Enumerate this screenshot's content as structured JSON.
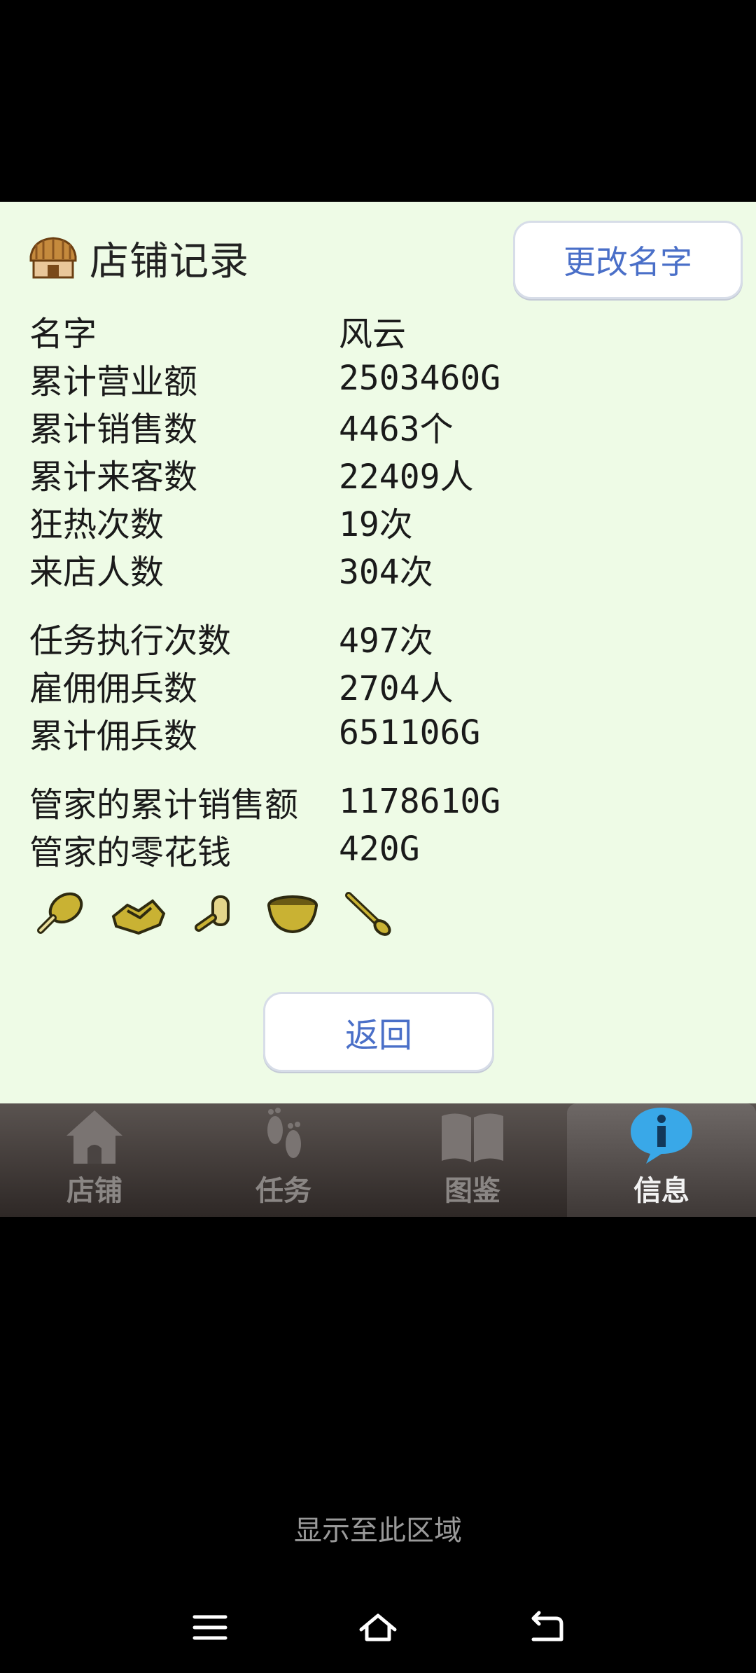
{
  "header": {
    "title": "店铺记录",
    "rename_label": "更改名字"
  },
  "stats": [
    [
      {
        "label": "名字",
        "value": "风云"
      },
      {
        "label": "累计营业额",
        "value": "2503460G"
      },
      {
        "label": "累计销售数",
        "value": "4463个"
      },
      {
        "label": "累计来客数",
        "value": "22409人"
      },
      {
        "label": "狂热次数",
        "value": "19次"
      },
      {
        "label": "来店人数",
        "value": "304次"
      }
    ],
    [
      {
        "label": "任务执行次数",
        "value": "497次"
      },
      {
        "label": "雇佣佣兵数",
        "value": "2704人"
      },
      {
        "label": "累计佣兵数",
        "value": "651106G"
      }
    ],
    [
      {
        "label": "管家的累计销售额",
        "value": "1178610G"
      },
      {
        "label": "管家的零花钱",
        "value": "420G"
      }
    ]
  ],
  "items": [
    "drumstick-icon",
    "shoe-icon",
    "bone-icon",
    "bowl-icon",
    "ladle-icon"
  ],
  "back_label": "返回",
  "tabs": [
    {
      "label": "店铺",
      "icon": "house-icon",
      "active": false
    },
    {
      "label": "任务",
      "icon": "footprints-icon",
      "active": false
    },
    {
      "label": "图鉴",
      "icon": "book-icon",
      "active": false
    },
    {
      "label": "信息",
      "icon": "info-icon",
      "active": true
    }
  ],
  "system_text": "显示至此区域",
  "nav": [
    "menu-icon",
    "home-icon",
    "back-icon"
  ],
  "colors": {
    "panel_bg": "#eefbe6",
    "button_text": "#4a6fc8",
    "tab_active_icon": "#39a8e8"
  }
}
